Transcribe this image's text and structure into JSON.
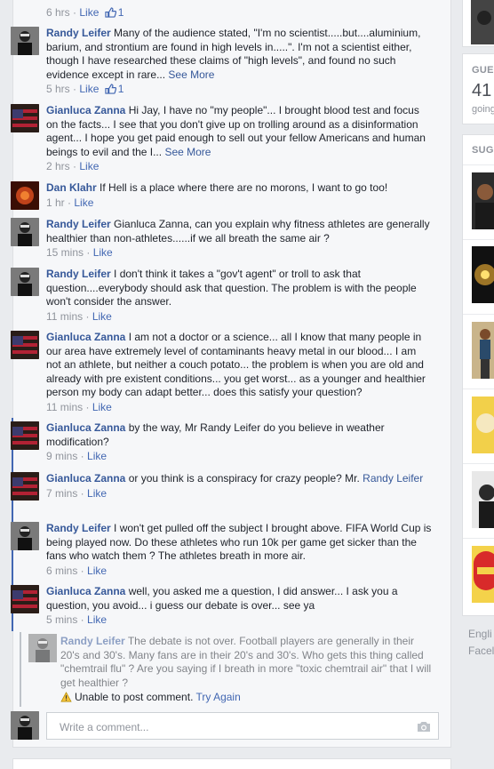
{
  "top": {
    "time": "6 hrs",
    "like": "Like",
    "likes": "1"
  },
  "comments": [
    {
      "author": "Randy Leifer",
      "text": "Many of the audience stated, \"I'm no scientist.....but....aluminium, barium, and strontium are found in high levels in.....\". I'm not a scientist either, though I have researched these claims of \"high levels\", and found no such evidence except in rare...",
      "see_more": "See More",
      "time": "5 hrs",
      "like": "Like",
      "likes": "1"
    },
    {
      "author": "Gianluca Zanna",
      "text": "Hi Jay, I have no \"my people\"... I brought blood test and focus on the facts... I see that you don't give up on trolling around as a disinformation agent... I hope you get paid enough to sell out your fellow Americans and human beings to evil and the I...",
      "see_more": "See More",
      "time": "2 hrs",
      "like": "Like"
    },
    {
      "author": "Dan Klahr",
      "text": "If Hell is a place where there are no morons, I want to go too!",
      "time": "1 hr",
      "like": "Like"
    },
    {
      "author": "Randy Leifer",
      "text": "Gianluca Zanna, can you explain why fitness athletes are generally healthier than non-athletes......if we all breath the same air ?",
      "time": "15 mins",
      "like": "Like"
    },
    {
      "author": "Randy Leifer",
      "text": "I don't think it takes a \"gov't agent\" or troll to ask that question....everybody should ask that question. The problem is with the people won't consider the answer.",
      "time": "11 mins",
      "like": "Like"
    },
    {
      "author": "Gianluca Zanna",
      "text": "I am not a doctor or a science... all I know that many people in our area have extremely level of contaminants heavy metal in our blood... I am not an athlete, but neither a couch potato... the problem is when you are old and already with pre existent conditions... you get worst... as a younger and healthier person my body can adapt better... does this satisfy your question?",
      "time": "11 mins",
      "like": "Like"
    },
    {
      "author": "Gianluca Zanna",
      "text": "by the way, Mr Randy Leifer do you believe in weather modification?",
      "time": "9 mins",
      "like": "Like"
    },
    {
      "author": "Gianluca Zanna",
      "text": "or you think is a conspiracy for crazy people? Mr.",
      "mention": "Randy Leifer",
      "time": "7 mins",
      "like": "Like"
    },
    {
      "author": "Randy Leifer",
      "text": "I won't get pulled off the subject I brought above. FIFA World Cup is being played now. Do these athletes who run 10k per game get sicker than the fans who watch them ? The athletes breath in more air.",
      "time": "6 mins",
      "like": "Like"
    },
    {
      "author": "Gianluca Zanna",
      "text": "well, you asked me a question, I did answer... I ask you a question, you avoid... i guess our debate is over... see ya",
      "time": "5 mins",
      "like": "Like"
    }
  ],
  "pending": {
    "author": "Randy Leifer",
    "text": "The debate is not over. Football players are generally in their 20's and 30's. Many fans are in their 20's and 30's. Who gets this thing called \"chemtrail flu\" ? Are you saying if I breath in more \"toxic chemtrail air\" that I will get healthier ?",
    "error": "Unable to post comment.",
    "retry": "Try Again"
  },
  "write": {
    "placeholder": "Write a comment..."
  },
  "sidebar": {
    "guests_label": "GUES",
    "guests_count": "41",
    "going": "going",
    "suggested_label": "SUGG",
    "footer_1": "Engli",
    "footer_2": "Facel"
  },
  "colors": {
    "link": "#365899",
    "meta": "#90949c",
    "thread": "#4267b2"
  }
}
